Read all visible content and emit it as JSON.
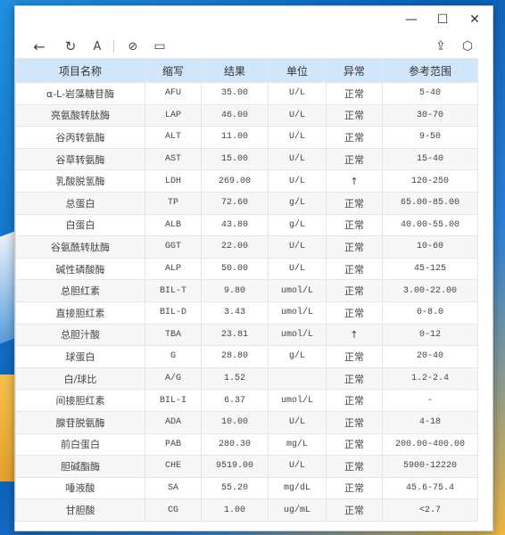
{
  "window": {
    "minimize": "—",
    "maximize": "☐",
    "close": "✕"
  },
  "toolbar": {
    "back": "←",
    "refresh": "↻",
    "font": "A",
    "link": "⊘",
    "panel": "▭",
    "share": "⇪",
    "cube": "⬡"
  },
  "table": {
    "headers": [
      "项目名称",
      "缩写",
      "结果",
      "单位",
      "异常",
      "参考范围"
    ],
    "rows": [
      [
        "α-L-岩藻糖苷酶",
        "AFU",
        "35.00",
        "U/L",
        "正常",
        "5-40"
      ],
      [
        "亮氨酸转肽酶",
        "LAP",
        "46.00",
        "U/L",
        "正常",
        "30-70"
      ],
      [
        "谷丙转氨酶",
        "ALT",
        "11.00",
        "U/L",
        "正常",
        "9-50"
      ],
      [
        "谷草转氨酶",
        "AST",
        "15.00",
        "U/L",
        "正常",
        "15-40"
      ],
      [
        "乳酸脱氢酶",
        "LDH",
        "269.00",
        "U/L",
        "↑",
        "120-250"
      ],
      [
        "总蛋白",
        "TP",
        "72.60",
        "g/L",
        "正常",
        "65.00-85.00"
      ],
      [
        "白蛋白",
        "ALB",
        "43.80",
        "g/L",
        "正常",
        "40.00-55.00"
      ],
      [
        "谷氨酰转肽酶",
        "GGT",
        "22.00",
        "U/L",
        "正常",
        "10-60"
      ],
      [
        "碱性磷酸酶",
        "ALP",
        "50.00",
        "U/L",
        "正常",
        "45-125"
      ],
      [
        "总胆红素",
        "BIL-T",
        "9.80",
        "umol/L",
        "正常",
        "3.00-22.00"
      ],
      [
        "直接胆红素",
        "BIL-D",
        "3.43",
        "umol/L",
        "正常",
        "0-8.0"
      ],
      [
        "总胆汁酸",
        "TBA",
        "23.81",
        "umol/L",
        "↑",
        "0-12"
      ],
      [
        "球蛋白",
        "G",
        "28.80",
        "g/L",
        "正常",
        "20-40"
      ],
      [
        "白/球比",
        "A/G",
        "1.52",
        "",
        "正常",
        "1.2-2.4"
      ],
      [
        "间接胆红素",
        "BIL-I",
        "6.37",
        "umol/L",
        "正常",
        "-"
      ],
      [
        "腺苷脱氨酶",
        "ADA",
        "10.00",
        "U/L",
        "正常",
        "4-18"
      ],
      [
        "前白蛋白",
        "PAB",
        "280.30",
        "mg/L",
        "正常",
        "200.00-400.00"
      ],
      [
        "胆碱酯酶",
        "CHE",
        "9519.00",
        "U/L",
        "正常",
        "5900-12220"
      ],
      [
        "唾液酸",
        "SA",
        "55.20",
        "mg/dL",
        "正常",
        "45.6-75.4"
      ],
      [
        "甘胆酸",
        "CG",
        "1.00",
        "ug/mL",
        "正常",
        "<2.7"
      ]
    ]
  }
}
